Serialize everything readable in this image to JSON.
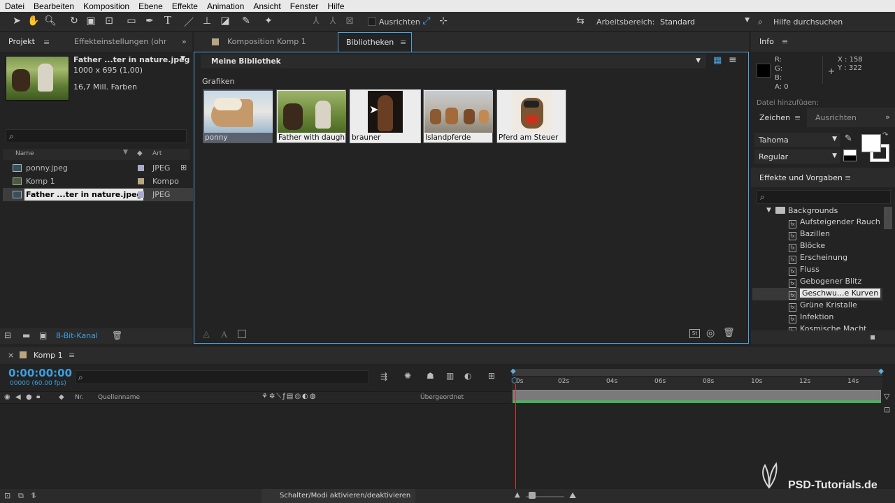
{
  "menu": [
    "Datei",
    "Bearbeiten",
    "Komposition",
    "Ebene",
    "Effekte",
    "Animation",
    "Ansicht",
    "Fenster",
    "Hilfe"
  ],
  "toolbar": {
    "align_label": "Ausrichten",
    "workspace_label": "Arbeitsbereich:",
    "workspace_value": "Standard",
    "help_placeholder": "Hilfe durchsuchen"
  },
  "project": {
    "tab_project": "Projekt",
    "tab_effects": "Effekteinstellungen (ohne",
    "preview_name": "Father ...ter in nature.jpeg",
    "preview_dims": "1000 x 695 (1,00)",
    "preview_colors": "16,7 Mill. Farben",
    "col_name": "Name",
    "col_type": "Art",
    "items": [
      {
        "name": "ponny.jpeg",
        "type": "JPEG"
      },
      {
        "name": "Komp 1",
        "type": "Kompo"
      },
      {
        "name": "Father ...ter in nature.jpeg",
        "type": "JPEG"
      }
    ],
    "bit_depth": "8-Bit-Kanal"
  },
  "center": {
    "tab_comp": "Komposition Komp 1",
    "tab_lib": "Bibliotheken",
    "library_name": "Meine Bibliothek",
    "section": "Grafiken",
    "thumbs": [
      "ponny",
      "Father with daugh...",
      "brauner",
      "Islandpferde",
      "Pferd am Steuer"
    ]
  },
  "info": {
    "title": "Info",
    "r": "R:",
    "g": "G:",
    "b": "B:",
    "a": "A:  0",
    "x": "X : 158",
    "y": "Y : 322",
    "extra": "Datei hinzufügen:"
  },
  "character": {
    "tab_zeichen": "Zeichen",
    "tab_ausrichten": "Ausrichten",
    "font": "Tahoma",
    "style": "Regular"
  },
  "effects": {
    "title": "Effekte und Vorgaben",
    "folder": "Backgrounds",
    "items": [
      "Aufsteigender Rauch",
      "Bazillen",
      "Blöcke",
      "Erscheinung",
      "Fluss",
      "Gebogener Blitz",
      "Geschwu...e Kurven",
      "Grüne Kristalle",
      "Infektion",
      "Kosmische Macht"
    ]
  },
  "timeline": {
    "tab": "Komp 1",
    "timecode": "0:00:00:00",
    "fps": "00000 (60.00 fps)",
    "col_nr": "Nr.",
    "col_source": "Quellenname",
    "col_parent": "Übergeordnet",
    "ticks": [
      "0s",
      "02s",
      "04s",
      "06s",
      "08s",
      "10s",
      "12s",
      "14s"
    ],
    "footer": "Schalter/Modi aktivieren/deaktivieren"
  },
  "watermark": "PSD-Tutorials.de"
}
